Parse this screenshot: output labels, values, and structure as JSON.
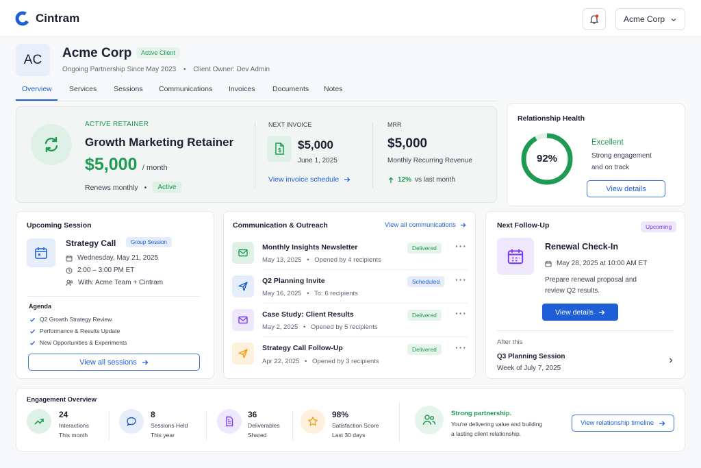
{
  "app": {
    "name": "Cintram"
  },
  "header": {
    "account": "Acme Corp"
  },
  "client": {
    "initials": "AC",
    "name": "Acme Corp",
    "status": "Active Client",
    "since": "Ongoing Partnership Since May 2023",
    "owner": "Client Owner: Dev Admin"
  },
  "tabs": [
    "Overview",
    "Services",
    "Sessions",
    "Communications",
    "Invoices",
    "Documents",
    "Notes"
  ],
  "retainer": {
    "eyebrow": "ACTIVE RETAINER",
    "title": "Growth Marketing Retainer",
    "amount": "$5,000",
    "period": "/ month",
    "renews": "Renews monthly",
    "status": "Active",
    "invoice_label": "NEXT INVOICE",
    "invoice_amount": "$5,000",
    "invoice_date": "June 1, 2025",
    "invoice_link": "View invoice schedule",
    "mrr_label": "MRR",
    "mrr_value": "$5,000",
    "mrr_sub": "Monthly Recurring Revenue",
    "mrr_change": "12%",
    "mrr_change_note": "vs last month"
  },
  "health": {
    "title": "Relationship Health",
    "percent": "92%",
    "fraction": 0.92,
    "status": "Excellent",
    "line1": "Strong engagement",
    "line2": "and on track",
    "button": "View details"
  },
  "session": {
    "title": "Upcoming Session",
    "name": "Strategy Call",
    "tag": "Group Session",
    "date": "Wednesday, May 21, 2025",
    "time": "2:00 – 3:00 PM ET",
    "with": "With: Acme Team + Cintram",
    "agenda_title": "Agenda",
    "agenda": [
      "Q2 Growth Strategy Review",
      "Performance & Results Update",
      "New Opportunities & Experiments"
    ],
    "button": "View all sessions"
  },
  "comms": {
    "title": "Communication & Outreach",
    "link": "View all communications",
    "items": [
      {
        "title": "Monthly Insights Newsletter",
        "date": "May 13, 2025",
        "detail": "Opened by 4 recipients",
        "status": "Delivered",
        "icon": "mail-icon"
      },
      {
        "title": "Q2 Planning Invite",
        "date": "May 16, 2025",
        "detail": "To: 6 recipients",
        "status": "Scheduled",
        "icon": "send-icon"
      },
      {
        "title": "Case Study: Client Results",
        "date": "May 2, 2025",
        "detail": "Opened by 5 recipients",
        "status": "Delivered",
        "icon": "mail-icon"
      },
      {
        "title": "Strategy Call Follow-Up",
        "date": "Apr 22, 2025",
        "detail": "Opened by 3 recipients",
        "status": "Delivered",
        "icon": "send-icon"
      }
    ]
  },
  "followup": {
    "title": "Next Follow-Up",
    "badge": "Upcoming",
    "name": "Renewal Check-In",
    "datetime": "May 28, 2025 at 10:00 AM ET",
    "desc1": "Prepare renewal proposal and",
    "desc2": "review Q2 results.",
    "button": "View details",
    "after_label": "After this",
    "after_title": "Q3 Planning Session",
    "after_date": "Week of July 7, 2025"
  },
  "engagement": {
    "title": "Engagement Overview",
    "stats": [
      {
        "value": "24",
        "label": "Interactions",
        "sub": "This month",
        "icon": "trend-up-icon"
      },
      {
        "value": "8",
        "label": "Sessions Held",
        "sub": "This year",
        "icon": "chat-icon"
      },
      {
        "value": "36",
        "label": "Deliverables",
        "sub": "Shared",
        "icon": "document-icon"
      },
      {
        "value": "98%",
        "label": "Satisfaction Score",
        "sub": "Last 30 days",
        "icon": "star-icon"
      }
    ],
    "partner_title": "Strong partnership.",
    "partner_line1": "You're delivering value and building",
    "partner_line2": "a lasting client relationship.",
    "button": "View relationship timeline"
  },
  "colors": {
    "accent": "#1f5fd6",
    "green": "#1e9a52",
    "purple": "#7c3aed",
    "orange": "#f59e0b"
  }
}
